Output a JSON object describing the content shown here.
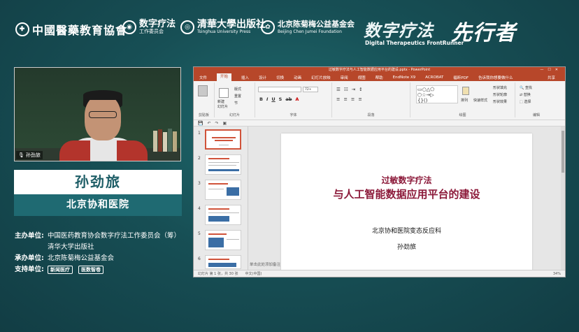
{
  "header": {
    "logo1_text": "中國醫藥教育協會",
    "logo2_line1": "数字疗法",
    "logo2_line2": "工作委员会",
    "logo3_line1": "清華大學出版社",
    "logo3_line2": "Tsinghua University Press",
    "logo4_line1": "北京陈菊梅公益基金会",
    "logo4_line2": "Beijing Chen Jumei Foundation",
    "brand_cn1": "数字疗法",
    "brand_cn2": "先行者",
    "brand_en": "Digital Therapeutics FrontRunner"
  },
  "video": {
    "camera_label": "孙劲旅"
  },
  "speaker": {
    "name": "孙劲旅",
    "org": "北京协和医院"
  },
  "organizers": {
    "host_key": "主办单位:",
    "host_value1": "中国医药教育协会数字疗法工作委员会（筹）",
    "host_value2": "清华大学出版社",
    "co_key": "承办单位:",
    "co_value": "北京陈菊梅公益基金会",
    "support_key": "支持单位:",
    "support_logo1": "新闻医疗",
    "support_logo2": "医数智卷"
  },
  "ppt": {
    "window_title": "过敏数字疗法与人工智能数据应用平台的建设.pptx - PowerPoint",
    "menu": [
      "文件",
      "开始",
      "插入",
      "设计",
      "切换",
      "动画",
      "幻灯片放映",
      "审阅",
      "视图",
      "帮助",
      "EndNote X9",
      "ACROBAT",
      "福昕PDF",
      "告诉我你想要做什么"
    ],
    "active_menu": "开始",
    "share": "共享",
    "ribbon_groups": [
      "剪贴板",
      "幻灯片",
      "字体",
      "段落",
      "绘图",
      "编辑"
    ],
    "ribbon_items": {
      "new_slide": "新建\n幻灯片",
      "layout": "版式",
      "reset": "重置",
      "section": "节",
      "font_size": "72+",
      "arrange": "排列",
      "quick_styles": "快速样式",
      "shape_fill": "形状填充",
      "shape_outline": "形状轮廓",
      "shape_effects": "形状效果",
      "find": "查找",
      "replace": "替换",
      "select": "选择"
    },
    "slide_numbers": [
      "1",
      "2",
      "3",
      "4",
      "5",
      "6"
    ],
    "slide": {
      "title_line1": "过敏数字疗法",
      "title_line2": "与人工智能数据应用平台的建设",
      "org": "北京协和医院变态反应科",
      "author": "孙劲旅"
    },
    "notes_placeholder": "单击此处添加备注",
    "status": {
      "slide_count": "幻灯片 第 1 张，共 30 张",
      "language": "中文(中国)",
      "zoom": "34%"
    }
  }
}
